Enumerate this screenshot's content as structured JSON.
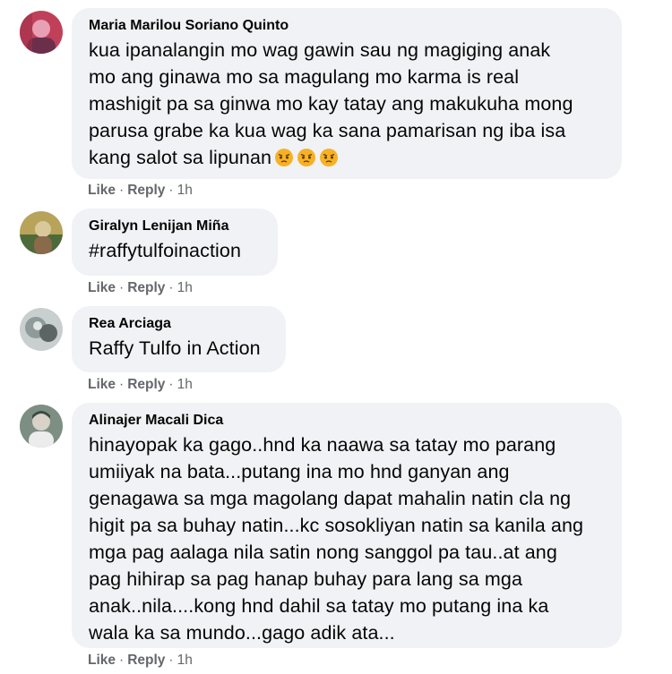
{
  "comments": [
    {
      "author": "Maria Marilou Soriano Quinto",
      "text": "kua ipanalangin mo wag gawin sau ng magiging anak\nmo ang ginawa mo sa magulang mo karma is real\nmashigit pa sa ginwa mo kay tatay ang makukuha mong\nparusa grabe ka kua wag ka sana pamarisan ng iba isa\nkang salot sa lipunan",
      "emojis": [
        "angry-face-icon",
        "angry-face-icon",
        "angry-face-icon"
      ],
      "like": "Like",
      "reply": "Reply",
      "time": "1h",
      "dot": "·",
      "avatar_colors": [
        "#c0405a",
        "#6b2f4a",
        "#e8a0b4"
      ]
    },
    {
      "author": "Giralyn Lenijan Miña",
      "text": "#raffytulfoinaction",
      "like": "Like",
      "reply": "Reply",
      "time": "1h",
      "dot": "·",
      "avatar_colors": [
        "#b7a35a",
        "#4d6a3a",
        "#d9c89a"
      ]
    },
    {
      "author": "Rea Arciaga",
      "text": "Raffy Tulfo in Action",
      "like": "Like",
      "reply": "Reply",
      "time": "1h",
      "dot": "·",
      "avatar_colors": [
        "#8f9a9a",
        "#5c6464",
        "#c9cfcf"
      ]
    },
    {
      "author": "Alinajer Macali Dica",
      "text": "hinayopak ka gago..hnd ka naawa sa tatay mo parang\numiiyak na bata...putang ina mo hnd ganyan ang\ngenagawa sa mga magolang dapat mahalin natin cla ng\nhigit pa sa buhay natin...kc sosokliyan natin sa kanila ang\nmga pag aalaga nila satin nong sanggol pa tau..at ang\npag hihirap sa pag hanap buhay para lang sa mga\nanak..nila....kong hnd dahil sa tatay mo putang ina ka\nwala ka sa mundo...gago adik ata...",
      "like": "Like",
      "reply": "Reply",
      "time": "1h",
      "dot": "·",
      "avatar_colors": [
        "#7d8e83",
        "#3e4a44",
        "#d8d2c8"
      ]
    }
  ]
}
